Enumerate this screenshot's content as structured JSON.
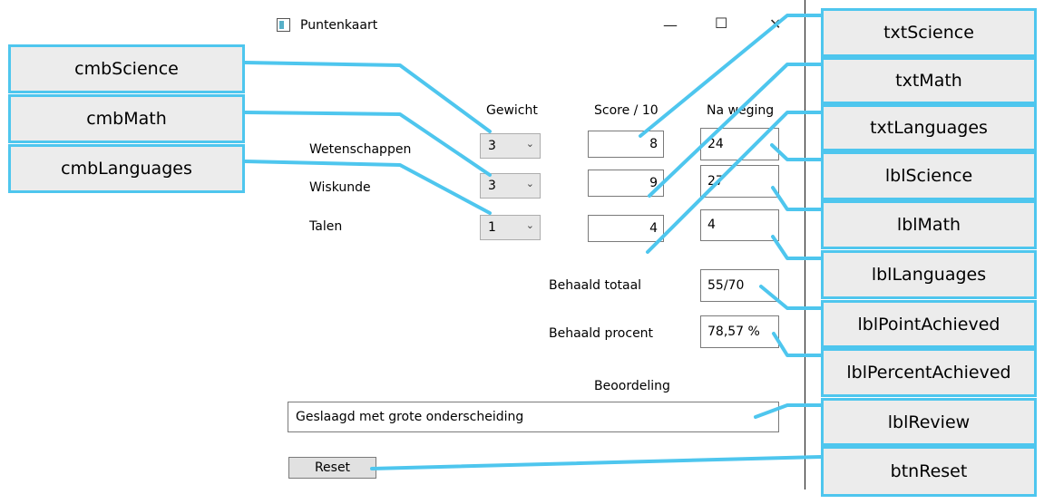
{
  "window": {
    "title": "Puntenkaart",
    "minimize_glyph": "—",
    "maximize_glyph": "☐",
    "close_glyph": "✕"
  },
  "headers": {
    "weight": "Gewicht",
    "score": "Score / 10",
    "weighted": "Na weging"
  },
  "rows": [
    {
      "subject": "Wetenschappen",
      "weight": "3",
      "score": "8",
      "weighted": "24"
    },
    {
      "subject": "Wiskunde",
      "weight": "3",
      "score": "9",
      "weighted": "27"
    },
    {
      "subject": "Talen",
      "weight": "1",
      "score": "4",
      "weighted": "4"
    }
  ],
  "totals": {
    "achieved_total_label": "Behaald totaal",
    "achieved_total_value": "55/70",
    "achieved_percent_label": "Behaald procent",
    "achieved_percent_value": "78,57 %"
  },
  "review": {
    "heading": "Beoordeling",
    "value": "Geslaagd met grote onderscheiding"
  },
  "reset_label": "Reset",
  "callouts": {
    "cmbScience": "cmbScience",
    "cmbMath": "cmbMath",
    "cmbLanguages": "cmbLanguages",
    "txtScience": "txtScience",
    "txtMath": "txtMath",
    "txtLanguages": "txtLanguages",
    "lblScience": "lblScience",
    "lblMath": "lblMath",
    "lblLanguages": "lblLanguages",
    "lblPointAchieved": "lblPointAchieved",
    "lblPercentAchieved": "lblPercentAchieved",
    "lblReview": "lblReview",
    "btnReset": "btnReset"
  },
  "colors": {
    "callout_border": "#4ec6ee",
    "callout_fill": "#ececec"
  }
}
